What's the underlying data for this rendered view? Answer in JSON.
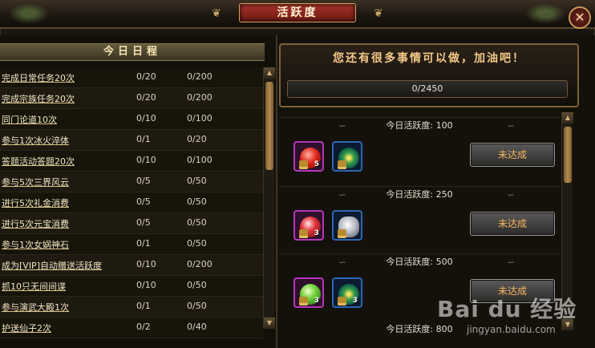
{
  "window": {
    "title": "活跃度",
    "close_label": "✕"
  },
  "schedule": {
    "title": "今日日程",
    "rows": [
      {
        "task": "完成日常任务20次",
        "progress": "0/20",
        "reward": "0/200"
      },
      {
        "task": "完成宗族任务20次",
        "progress": "0/20",
        "reward": "0/200"
      },
      {
        "task": "同门论道10次",
        "progress": "0/10",
        "reward": "0/100"
      },
      {
        "task": "参与1次冰火淬体",
        "progress": "0/1",
        "reward": "0/20"
      },
      {
        "task": "答题活动答题20次",
        "progress": "0/10",
        "reward": "0/100"
      },
      {
        "task": "参与5次三界风云",
        "progress": "0/5",
        "reward": "0/50"
      },
      {
        "task": "进行5次礼金消费",
        "progress": "0/5",
        "reward": "0/50"
      },
      {
        "task": "进行5次元宝消费",
        "progress": "0/5",
        "reward": "0/50"
      },
      {
        "task": "参与1次女娲神石",
        "progress": "0/1",
        "reward": "0/50"
      },
      {
        "task": "成为[VIP]自动赠送活跃度",
        "progress": "0/10",
        "reward": "0/200"
      },
      {
        "task": "抓10只无间间谍",
        "progress": "0/10",
        "reward": "0/50"
      },
      {
        "task": "参与演武大殿1次",
        "progress": "0/1",
        "reward": "0/50"
      },
      {
        "task": "护送仙子2次",
        "progress": "0/2",
        "reward": "0/40"
      }
    ]
  },
  "summary": {
    "message": "您还有很多事情可以做，加油吧！",
    "total": "0/2450",
    "fill_fraction": 0
  },
  "tiers": [
    {
      "label": "今日活跃度:  100",
      "button": "未达成",
      "items": [
        {
          "icon": "red-gem-icon",
          "frame": "purple",
          "qty": "5"
        },
        {
          "icon": "green-swirl-icon",
          "frame": "blue",
          "qty": ""
        }
      ]
    },
    {
      "label": "今日活跃度:  250",
      "button": "未达成",
      "items": [
        {
          "icon": "red-orb-icon",
          "frame": "purple",
          "qty": "3"
        },
        {
          "icon": "silver-ingot-icon",
          "frame": "blue",
          "qty": ""
        }
      ]
    },
    {
      "label": "今日活跃度:  500",
      "button": "未达成",
      "items": [
        {
          "icon": "green-orb-icon",
          "frame": "purple",
          "qty": "3"
        },
        {
          "icon": "green-swirl-icon",
          "frame": "blue",
          "qty": "3"
        }
      ]
    }
  ],
  "next_tier_partial": "今日活跃度:  800",
  "watermark": {
    "logo": "Bai du 经验",
    "url": "jingyan.baidu.com"
  },
  "colors": {
    "title_plate": "#8a2a22",
    "gold_text": "#f3c98a",
    "button_text": "#f5b561"
  }
}
